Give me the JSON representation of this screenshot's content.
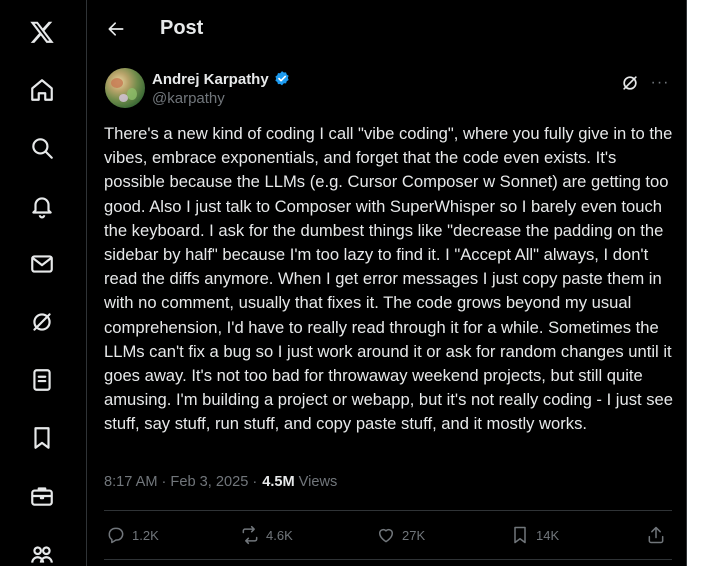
{
  "header": {
    "title": "Post"
  },
  "nav": {
    "items": [
      {
        "name": "x-logo",
        "label": "X"
      },
      {
        "name": "home",
        "label": "Home"
      },
      {
        "name": "explore",
        "label": "Explore"
      },
      {
        "name": "notifications",
        "label": "Notifications"
      },
      {
        "name": "messages",
        "label": "Messages"
      },
      {
        "name": "grok",
        "label": "Grok"
      },
      {
        "name": "lists",
        "label": "Lists"
      },
      {
        "name": "bookmarks",
        "label": "Bookmarks"
      },
      {
        "name": "jobs",
        "label": "Jobs"
      },
      {
        "name": "communities",
        "label": "Communities"
      }
    ]
  },
  "post": {
    "author_name": "Andrej Karpathy",
    "author_handle": "@karpathy",
    "verified": true,
    "text": "There's a new kind of coding I call \"vibe coding\", where you fully give in to the vibes, embrace exponentials, and forget that the code even exists. It's possible because the LLMs (e.g. Cursor Composer w Sonnet) are getting too good. Also I just talk to Composer with SuperWhisper so I barely even touch the keyboard. I ask for the dumbest things like \"decrease the padding on the sidebar by half\" because I'm too lazy to find it. I \"Accept All\" always, I don't read the diffs anymore. When I get error messages I just copy paste them in with no comment, usually that fixes it. The code grows beyond my usual comprehension, I'd have to really read through it for a while. Sometimes the LLMs can't fix a bug so I just work around it or ask for random changes until it goes away. It's not too bad for throwaway weekend projects, but still quite amusing. I'm building a project or webapp, but it's not really coding - I just see stuff, say stuff, run stuff, and copy paste stuff, and it mostly works.",
    "time": "8:17 AM",
    "date": "Feb 3, 2025",
    "separator": "·",
    "views_count": "4.5M",
    "views_label": "Views"
  },
  "actions": {
    "replies": "1.2K",
    "reposts": "4.6K",
    "likes": "27K",
    "bookmarks": "14K"
  },
  "colors": {
    "background": "#000000",
    "text": "#e7e9ea",
    "muted": "#71767b",
    "border": "#2f3336",
    "verified": "#1d9bf0"
  }
}
